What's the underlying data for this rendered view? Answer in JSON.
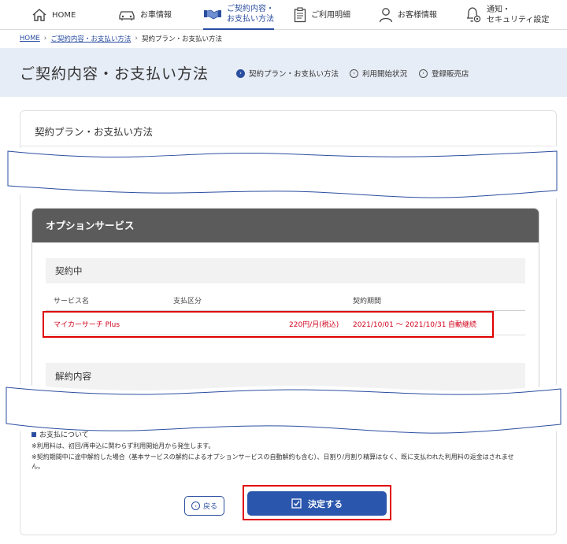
{
  "nav": {
    "items": [
      {
        "label": "HOME",
        "icon": "home-icon"
      },
      {
        "label": "お車情報",
        "icon": "car-icon"
      },
      {
        "label": "ご契約内容・\nお支払い方法",
        "icon": "handshake-icon",
        "active": true
      },
      {
        "label": "ご利用明細",
        "icon": "clipboard-icon"
      },
      {
        "label": "お客様情報",
        "icon": "person-icon"
      },
      {
        "label": "通知・\nセキュリティ設定",
        "icon": "bell-gear-icon"
      }
    ]
  },
  "breadcrumb": {
    "home": "HOME",
    "parent": "ご契約内容・お支払い方法",
    "current": "契約プラン・お支払い方法"
  },
  "header": {
    "title": "ご契約内容・お支払い方法",
    "anchors": [
      {
        "label": "契約プラン・お支払い方法",
        "current": true
      },
      {
        "label": "利用開始状況"
      },
      {
        "label": "登録販売店"
      }
    ]
  },
  "card": {
    "title": "契約プラン・お支払い方法"
  },
  "option": {
    "title": "オプションサービス",
    "contracted_title": "契約中",
    "columns": [
      "サービス名",
      "支払区分",
      "契約期間"
    ],
    "rows": [
      {
        "service": "マイカーサーチ Plus",
        "price": "220円/月(税込)",
        "period": "2021/10/01 ～ 2021/10/31",
        "status": "自動継続"
      }
    ],
    "cancel_title": "解約内容"
  },
  "notes": {
    "title": "お支払について",
    "lines": [
      "※利用料は、初回/再申込に関わらず利用開始月から発生します。",
      "※契約期間中に途中解約した場合（基本サービスの解約によるオプションサービスの自動解約も含む）、日割り/月割り精算はなく、既に支払われた利用料の返金はされませ",
      "ん。"
    ]
  },
  "buttons": {
    "back": "戻る",
    "confirm": "決定する"
  },
  "colors": {
    "accent": "#2b4ea0",
    "highlight": "#e00000",
    "price_text": "#d0021b",
    "panel_header": "#5b5b5b"
  }
}
